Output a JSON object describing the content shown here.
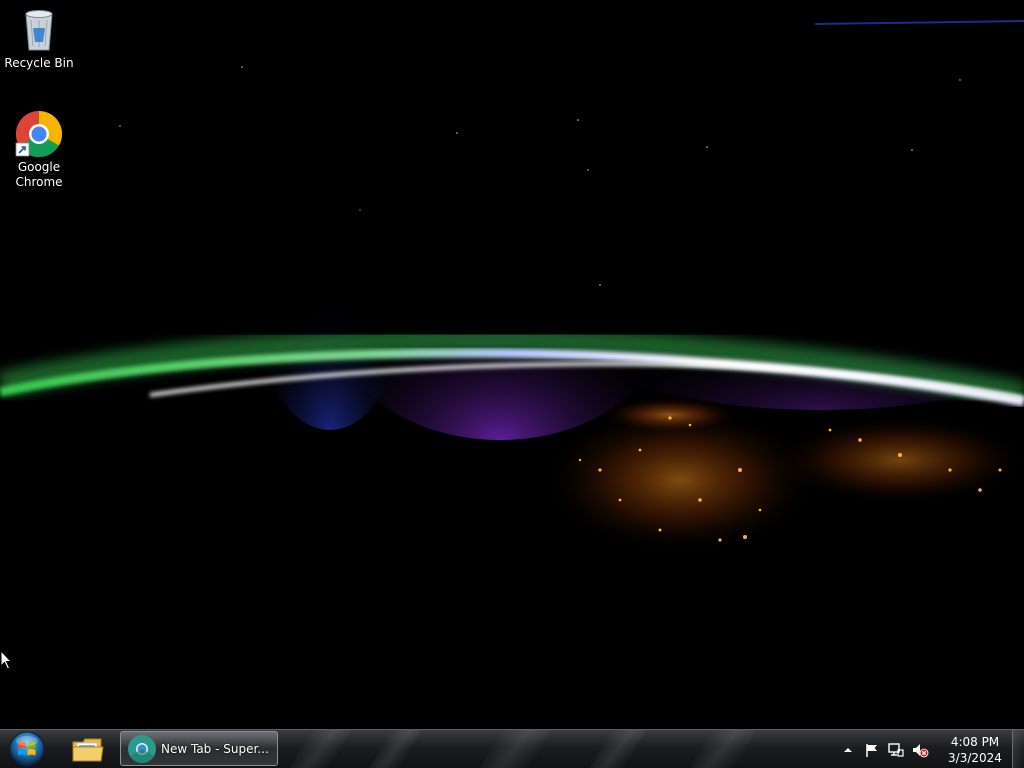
{
  "desktop": {
    "icons": [
      {
        "label": "Recycle Bin",
        "icon": "recycle-bin-icon"
      },
      {
        "label": "Google Chrome",
        "icon": "chrome-icon"
      }
    ]
  },
  "taskbar": {
    "start_icon": "windows-start-orb-icon",
    "pinned": [
      {
        "icon": "file-explorer-icon"
      }
    ],
    "task_buttons": [
      {
        "label": "New Tab - Super...",
        "icon": "chrome-icon"
      }
    ],
    "tray": {
      "icons": [
        "show-hidden-icons-arrow-icon",
        "action-center-flag-icon",
        "network-icon",
        "volume-muted-icon"
      ],
      "time": "4:08 PM",
      "date": "3/3/2024"
    }
  }
}
